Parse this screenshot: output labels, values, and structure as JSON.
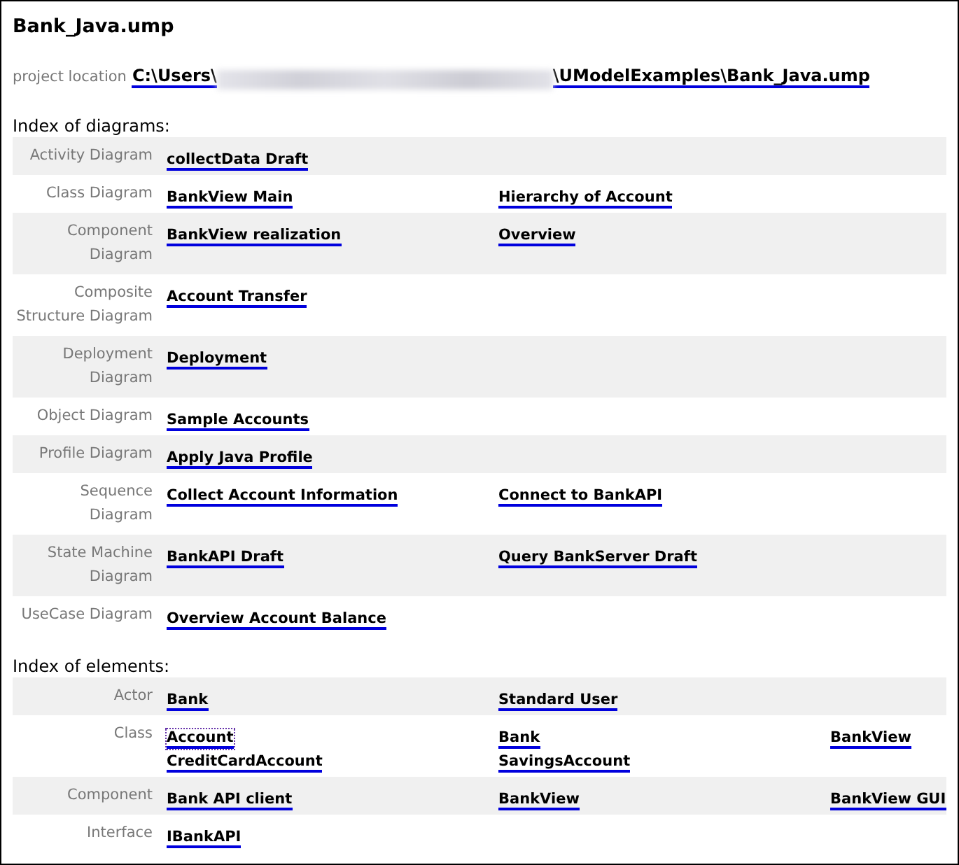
{
  "title": "Bank_Java.ump",
  "location": {
    "label": "project location",
    "path_start": "C:\\Users\\",
    "path_end": "\\UModelExamples\\Bank_Java.ump"
  },
  "sections": [
    {
      "heading": "Index of diagrams:",
      "rows": [
        {
          "label": "Activity Diagram",
          "links": [
            {
              "text": "collectData Draft",
              "focused": false
            }
          ]
        },
        {
          "label": "Class Diagram",
          "links": [
            {
              "text": "BankView Main",
              "focused": false
            },
            {
              "text": "Hierarchy of Account",
              "focused": false
            }
          ]
        },
        {
          "label": "Component\nDiagram",
          "links": [
            {
              "text": "BankView realization",
              "focused": false
            },
            {
              "text": "Overview",
              "focused": false
            }
          ]
        },
        {
          "label": "Composite\nStructure Diagram",
          "links": [
            {
              "text": "Account Transfer",
              "focused": false
            }
          ]
        },
        {
          "label": "Deployment\nDiagram",
          "links": [
            {
              "text": "Deployment",
              "focused": false
            }
          ]
        },
        {
          "label": "Object Diagram",
          "links": [
            {
              "text": "Sample Accounts",
              "focused": false
            }
          ]
        },
        {
          "label": "Profile Diagram",
          "links": [
            {
              "text": "Apply Java Profile",
              "focused": false
            }
          ]
        },
        {
          "label": "Sequence\nDiagram",
          "links": [
            {
              "text": "Collect Account Information",
              "focused": false
            },
            {
              "text": "Connect to BankAPI",
              "focused": false
            }
          ]
        },
        {
          "label": "State Machine\nDiagram",
          "links": [
            {
              "text": "BankAPI Draft",
              "focused": false
            },
            {
              "text": "Query BankServer Draft",
              "focused": false
            }
          ]
        },
        {
          "label": "UseCase Diagram",
          "links": [
            {
              "text": "Overview Account Balance",
              "focused": false
            }
          ]
        }
      ]
    },
    {
      "heading": "Index of elements:",
      "rows": [
        {
          "label": "Actor",
          "links": [
            {
              "text": "Bank",
              "focused": false
            },
            {
              "text": "Standard User",
              "focused": false
            }
          ]
        },
        {
          "label": "Class",
          "links": [
            {
              "text": "Account",
              "focused": true
            },
            {
              "text": "Bank",
              "focused": false
            },
            {
              "text": "BankView",
              "focused": false
            },
            {
              "text": "CreditCardAccount",
              "focused": false
            },
            {
              "text": "SavingsAccount",
              "focused": false
            }
          ]
        },
        {
          "label": "Component",
          "links": [
            {
              "text": "Bank API client",
              "focused": false
            },
            {
              "text": "BankView",
              "focused": false
            },
            {
              "text": "BankView GUI",
              "focused": false
            }
          ]
        },
        {
          "label": "Interface",
          "links": [
            {
              "text": "IBankAPI",
              "focused": false
            }
          ]
        }
      ]
    }
  ]
}
